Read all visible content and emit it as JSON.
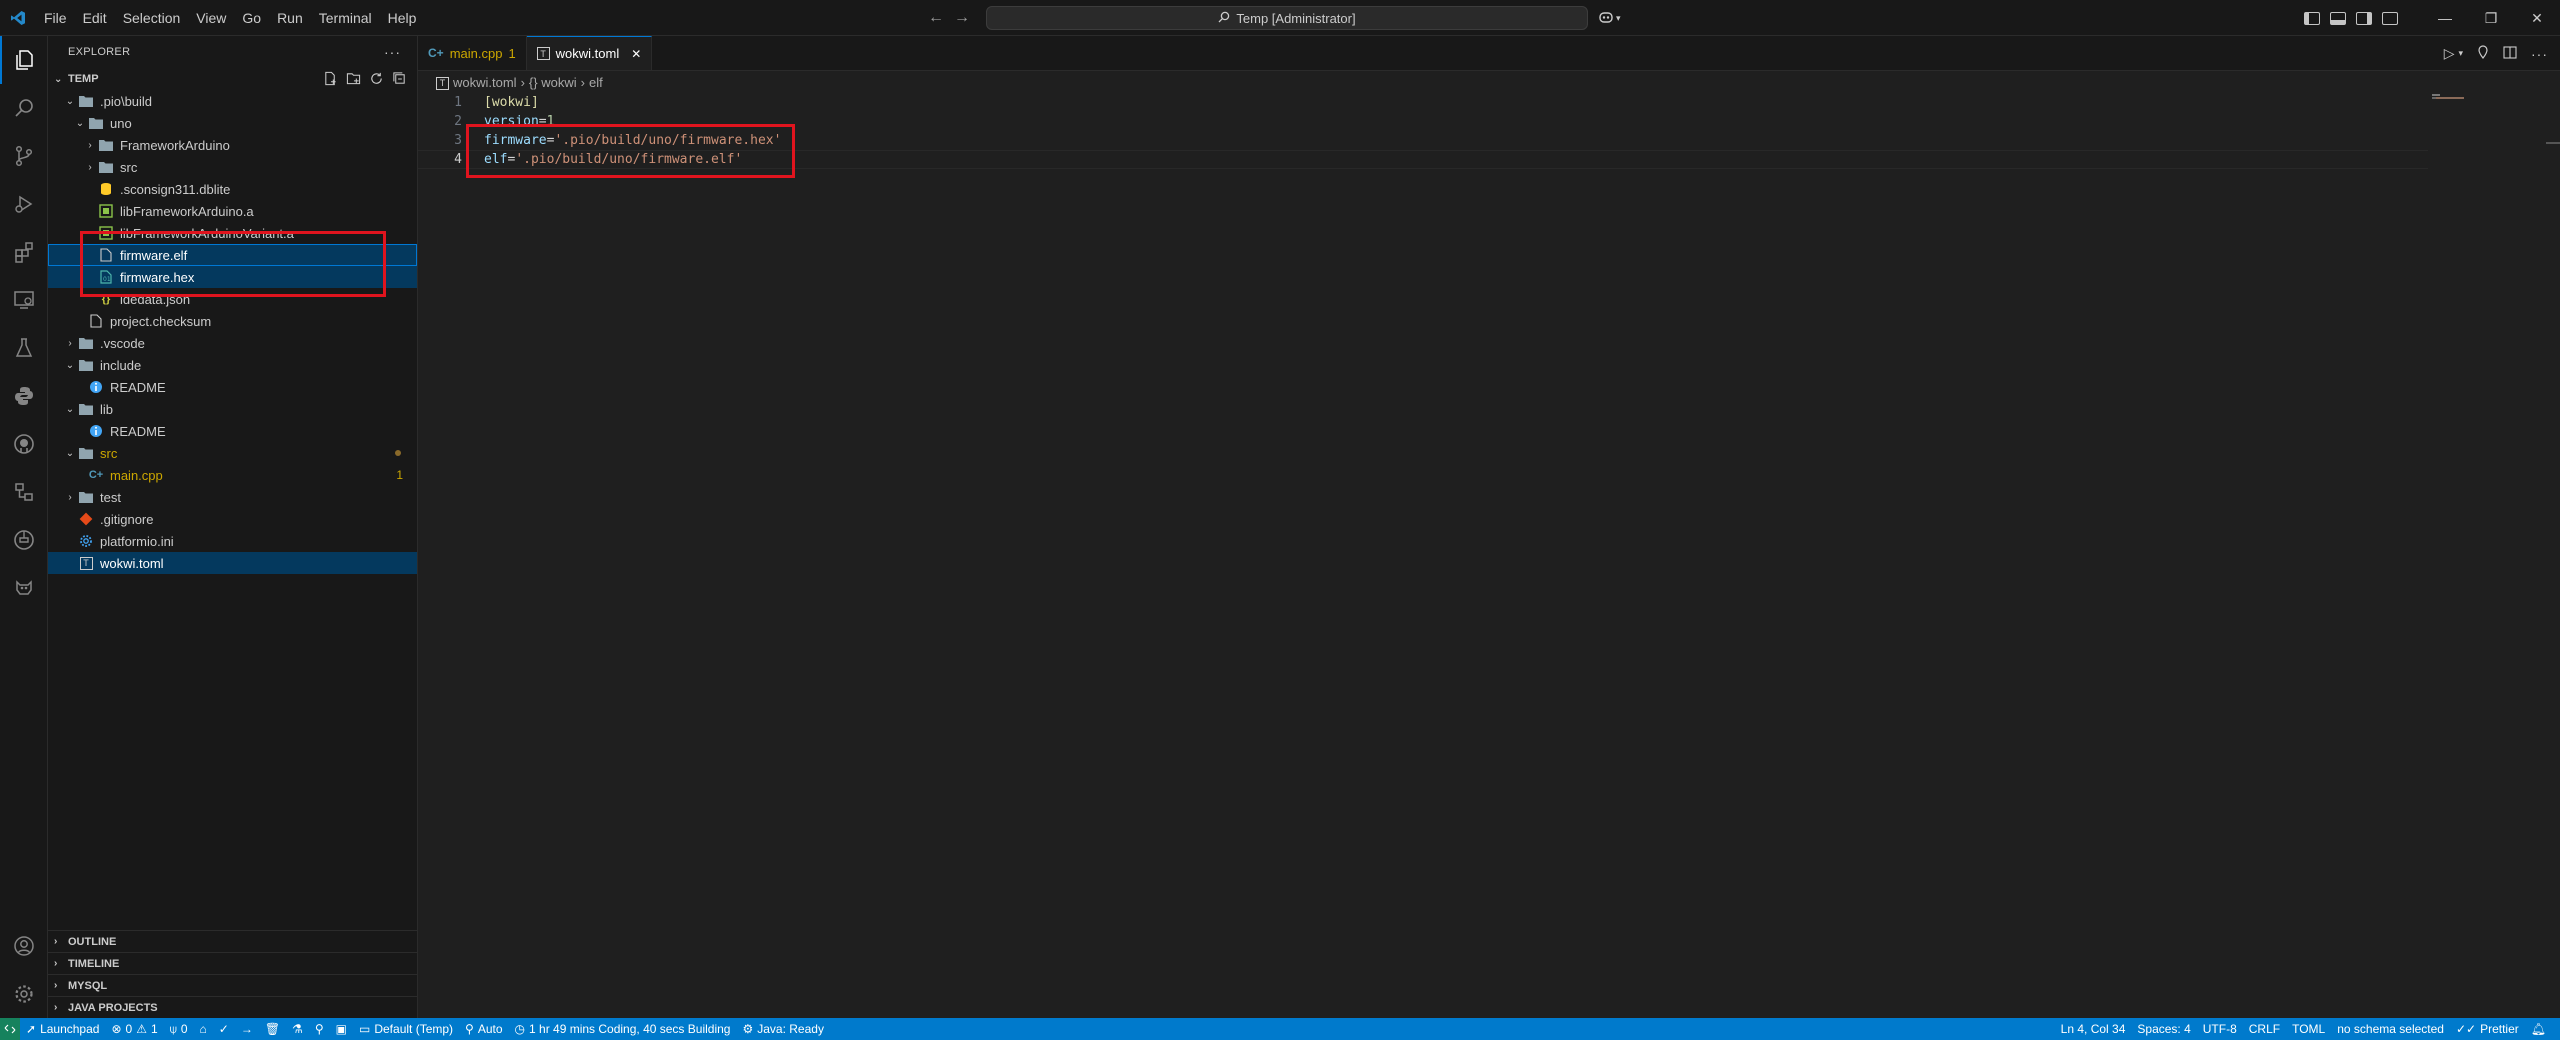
{
  "menu": [
    "File",
    "Edit",
    "Selection",
    "View",
    "Go",
    "Run",
    "Terminal",
    "Help"
  ],
  "command_center": "Temp [Administrator]",
  "sidebar": {
    "title": "EXPLORER",
    "section": "TEMP",
    "tree": [
      {
        "label": ".pio\\build",
        "depth": 0,
        "kind": "folder-open",
        "color": "#cccccc"
      },
      {
        "label": "uno",
        "depth": 1,
        "kind": "folder-open",
        "color": "#cccccc"
      },
      {
        "label": "FrameworkArduino",
        "depth": 2,
        "kind": "folder",
        "color": "#cccccc"
      },
      {
        "label": "src",
        "depth": 2,
        "kind": "folder",
        "color": "#cccccc"
      },
      {
        "label": ".sconsign311.dblite",
        "depth": 2,
        "kind": "db",
        "color": "#cccccc"
      },
      {
        "label": "libFrameworkArduino.a",
        "depth": 2,
        "kind": "lib",
        "color": "#cccccc"
      },
      {
        "label": "libFrameworkArduinoVariant.a",
        "depth": 2,
        "kind": "lib",
        "color": "#cccccc"
      },
      {
        "label": "firmware.elf",
        "depth": 2,
        "kind": "file",
        "color": "#ffffff"
      },
      {
        "label": "firmware.hex",
        "depth": 2,
        "kind": "hex",
        "color": "#ffffff"
      },
      {
        "label": "idedata.json",
        "depth": 2,
        "kind": "json",
        "color": "#cccccc"
      },
      {
        "label": "project.checksum",
        "depth": 1,
        "kind": "file",
        "color": "#cccccc"
      },
      {
        "label": ".vscode",
        "depth": 0,
        "kind": "folder",
        "color": "#cccccc"
      },
      {
        "label": "include",
        "depth": 0,
        "kind": "folder-open",
        "color": "#cccccc"
      },
      {
        "label": "README",
        "depth": 1,
        "kind": "info",
        "color": "#cccccc"
      },
      {
        "label": "lib",
        "depth": 0,
        "kind": "folder-open",
        "color": "#cccccc"
      },
      {
        "label": "README",
        "depth": 1,
        "kind": "info",
        "color": "#cccccc"
      },
      {
        "label": "src",
        "depth": 0,
        "kind": "folder-open",
        "color": "#cca700"
      },
      {
        "label": "main.cpp",
        "depth": 1,
        "kind": "cpp",
        "color": "#cca700"
      },
      {
        "label": "test",
        "depth": 0,
        "kind": "folder",
        "color": "#cccccc"
      },
      {
        "label": ".gitignore",
        "depth": 0,
        "kind": "git",
        "color": "#cccccc"
      },
      {
        "label": "platformio.ini",
        "depth": 0,
        "kind": "gear",
        "color": "#cccccc"
      },
      {
        "label": "wokwi.toml",
        "depth": 0,
        "kind": "toml",
        "color": "#ffffff"
      }
    ],
    "main_cpp_problems": "1",
    "bottom_sections": [
      "OUTLINE",
      "TIMELINE",
      "MYSQL",
      "JAVA PROJECTS"
    ]
  },
  "tabs": [
    {
      "label": "main.cpp",
      "badge": "1"
    },
    {
      "label": "wokwi.toml",
      "close": "✕"
    }
  ],
  "breadcrumb": [
    "wokwi.toml",
    "{} wokwi",
    "elf"
  ],
  "code_lines": [
    {
      "n": "1",
      "parts": [
        {
          "t": "[wokwi]",
          "c": "k-sec"
        }
      ]
    },
    {
      "n": "2",
      "parts": [
        {
          "t": "version",
          "c": "k-key"
        },
        {
          "t": "=",
          "c": "k-eq"
        },
        {
          "t": "1",
          "c": "k-num"
        }
      ]
    },
    {
      "n": "3",
      "parts": [
        {
          "t": "firmware",
          "c": "k-key"
        },
        {
          "t": "=",
          "c": "k-eq"
        },
        {
          "t": "'.pio/build/uno/firmware.hex'",
          "c": "k-str"
        }
      ]
    },
    {
      "n": "4",
      "parts": [
        {
          "t": "elf",
          "c": "k-key"
        },
        {
          "t": "=",
          "c": "k-eq"
        },
        {
          "t": "'.pio/build/uno/firmware.elf'",
          "c": "k-str"
        }
      ]
    }
  ],
  "status": {
    "launchpad": "Launchpad",
    "errors": "0",
    "warnings": "1",
    "ports": "0",
    "profile": "Default (Temp)",
    "auto": "Auto",
    "wakatime": "1 hr 49 mins Coding, 40 secs Building",
    "java": "Java: Ready",
    "position": "Ln 4, Col 34",
    "spaces": "Spaces: 4",
    "encoding": "UTF-8",
    "eol": "CRLF",
    "language": "TOML",
    "schema": "no schema selected",
    "prettier": "Prettier"
  },
  "colors": {
    "accent": "#0078d4",
    "statusbar": "#007acc",
    "highlight_box": "#e0141e",
    "modified": "#cca700"
  }
}
